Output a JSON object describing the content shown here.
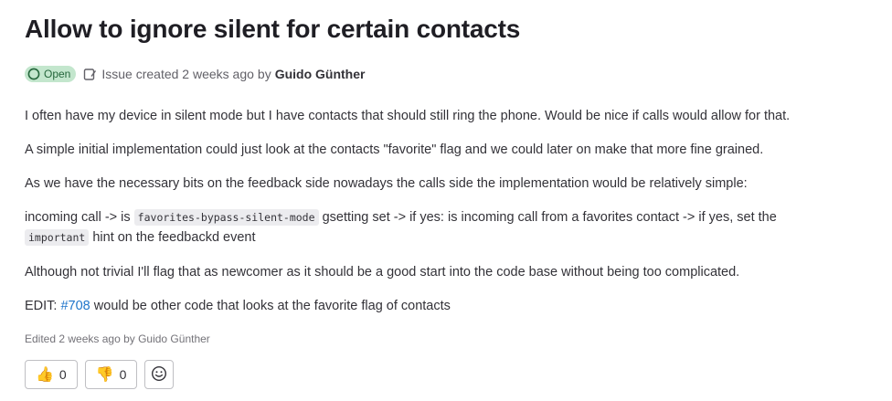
{
  "issue": {
    "title": "Allow to ignore silent for certain contacts",
    "status": "Open",
    "created_text": "Issue created 2 weeks ago",
    "by_text": "by",
    "author": "Guido Günther"
  },
  "description": {
    "p1": "I often have my device in silent mode but I have contacts that should still ring the phone. Would be nice if calls would allow for that.",
    "p2": "A simple initial implementation could just look at the contacts \"favorite\" flag and we could later on make that more fine grained.",
    "p3": "As we have the necessary bits on the feedback side nowadays the calls side the implementation would be relatively simple:",
    "p4_pre": "incoming call -> is ",
    "p4_code1": "favorites-bypass-silent-mode",
    "p4_mid": " gsetting set -> if yes: is incoming call from a favorites contact -> if yes, set the",
    "p4_code2": "important",
    "p4_post": " hint on the feedbackd event",
    "p5": "Although not trivial I'll flag that as newcomer as it should be a good start into the code base without being too complicated.",
    "p6_pre": "EDIT: ",
    "p6_link": "#708",
    "p6_post": " would be other code that looks at the favorite flag of contacts"
  },
  "edited_text": "Edited 2 weeks ago by Guido Günther",
  "reactions": {
    "thumbs_up_emoji": "👍",
    "thumbs_up_count": "0",
    "thumbs_down_emoji": "👎",
    "thumbs_down_count": "0",
    "add_reaction_icon": "smiley-icon"
  },
  "colors": {
    "status_bg": "#c3e6cd",
    "status_fg": "#24663b",
    "link": "#1f75cb"
  }
}
